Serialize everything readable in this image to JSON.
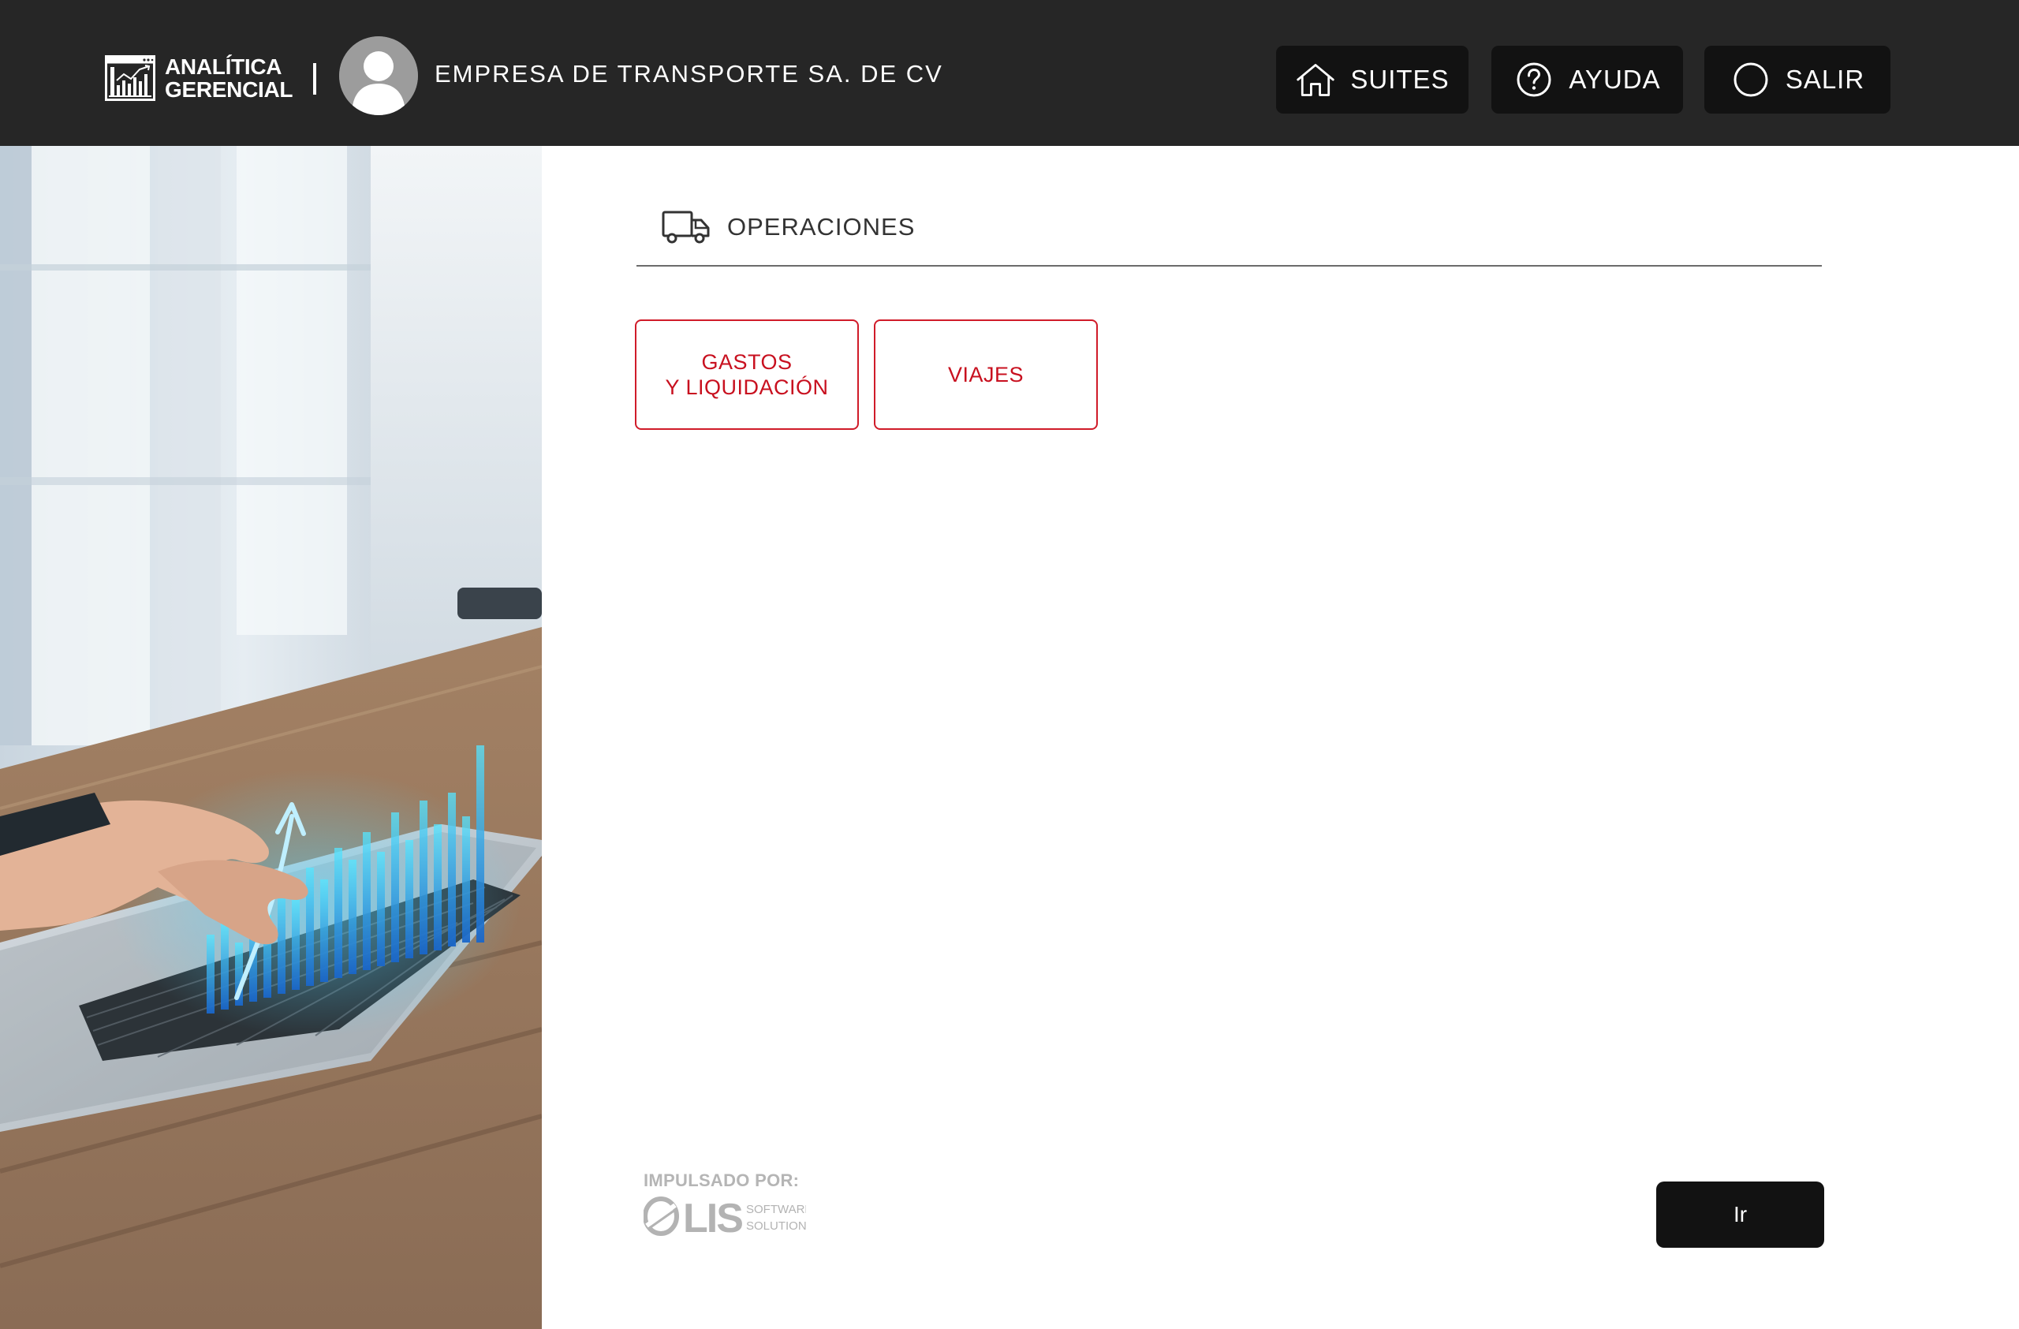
{
  "header": {
    "logo": {
      "line1": "ANALÍTICA",
      "line2": "GERENCIAL",
      "icon": "analytics-chart-icon"
    },
    "avatar_icon": "user-avatar-icon",
    "company_name": "EMPRESA DE TRANSPORTE SA. DE CV",
    "nav": {
      "suites": {
        "label": "SUITES",
        "icon": "home-icon"
      },
      "help": {
        "label": "AYUDA",
        "icon": "question-circle-icon"
      },
      "logout": {
        "label": "SALIR",
        "icon": "power-circle-icon"
      }
    },
    "background_color": "#262626",
    "button_color": "#121212"
  },
  "side_image": {
    "description_icon": "laptop-analytics-photo"
  },
  "section": {
    "icon": "truck-icon",
    "title": "OPERACIONES"
  },
  "options": [
    {
      "line1": "GASTOS",
      "line2": "Y LIQUIDACIÓN"
    },
    {
      "line1": "VIAJES"
    }
  ],
  "accent_color": "#c8101f",
  "footer": {
    "powered_by": "IMPULSADO POR:",
    "brand": {
      "name": "LIS",
      "tag_line1": "SOFTWARE",
      "tag_line2": "SOLUTIONS"
    },
    "go_button": "Ir"
  }
}
